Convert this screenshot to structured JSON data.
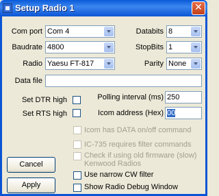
{
  "window": {
    "title": "Setup Radio 1",
    "close_glyph": "✕"
  },
  "icons": {
    "window_icon": "app-icon",
    "close": "close-icon",
    "dropdown": "chevron-down-icon"
  },
  "colors": {
    "titlebar": "#0b55d4",
    "dialog_bg": "#ece9d8",
    "selection": "#316ac5"
  },
  "form": {
    "com_port": {
      "label": "Com port",
      "value": "Com 4"
    },
    "baudrate": {
      "label": "Baudrate",
      "value": "4800"
    },
    "radio": {
      "label": "Radio",
      "value": "Yaesu FT-817"
    },
    "databits": {
      "label": "Databits",
      "value": "8"
    },
    "stopbits": {
      "label": "StopBits",
      "value": "1"
    },
    "parity": {
      "label": "Parity",
      "value": "None"
    },
    "data_file": {
      "label": "Data file",
      "value": ""
    },
    "polling": {
      "label": "Polling interval (ms)",
      "value": "250"
    },
    "icom_address": {
      "label": "Icom address (Hex)",
      "value": "00"
    }
  },
  "checkboxes": {
    "dtr": {
      "label": "Set DTR high",
      "checked": false
    },
    "rts": {
      "label": "Set RTS high",
      "checked": false
    },
    "icom_data": {
      "label": "Icom has DATA on/off command",
      "enabled": false
    },
    "ic735": {
      "label": "IC-735 requires filter commands",
      "enabled": false
    },
    "kenwood_line1": {
      "label": "Check if using old firmware (slow)",
      "enabled": false
    },
    "kenwood_line2": "Kenwood Radios",
    "narrow_cw": {
      "label": "Use narrow CW filter",
      "checked": false
    },
    "debug": {
      "label": "Show Radio Debug Window",
      "checked": false
    }
  },
  "buttons": {
    "cancel": "Cancel",
    "apply": "Apply"
  }
}
